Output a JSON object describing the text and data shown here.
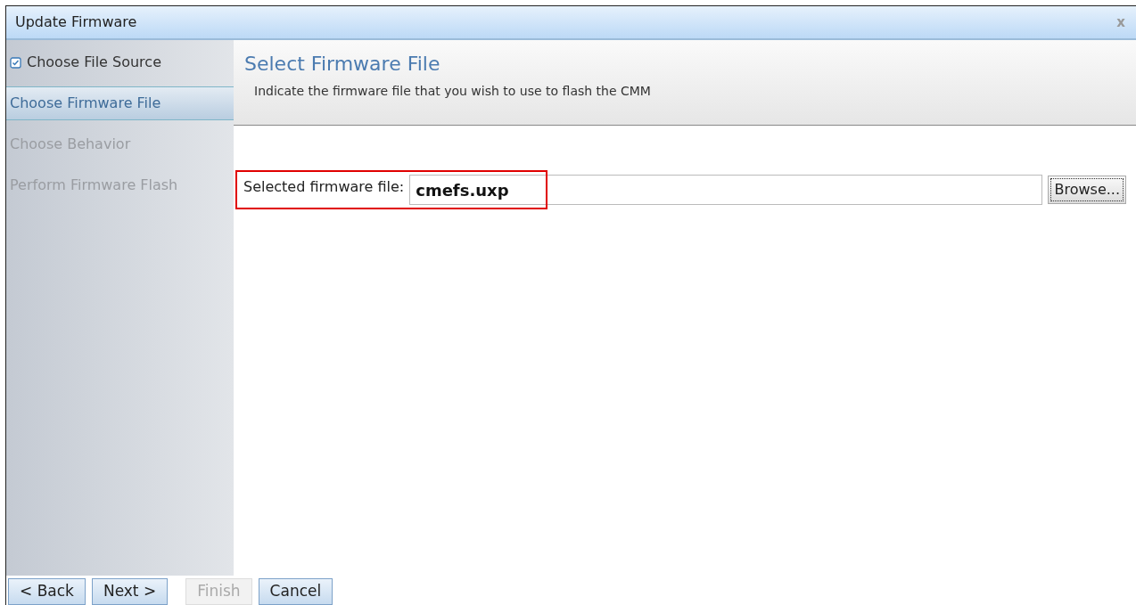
{
  "window": {
    "title": "Update Firmware",
    "close": "x"
  },
  "steps": [
    {
      "label": "Choose File Source",
      "checked": true,
      "selected": false,
      "disabled": false
    },
    {
      "label": "Choose Firmware File",
      "checked": false,
      "selected": true,
      "disabled": false
    },
    {
      "label": "Choose Behavior",
      "checked": false,
      "selected": false,
      "disabled": true
    },
    {
      "label": "Perform Firmware Flash",
      "checked": false,
      "selected": false,
      "disabled": true
    }
  ],
  "header": {
    "title": "Select Firmware File",
    "description": "Indicate the firmware file that you wish to use to flash the CMM"
  },
  "file_field": {
    "label": "Selected firmware file:",
    "value": "cmefs.uxp",
    "highlighted": true,
    "browse": "Browse..."
  },
  "buttons": [
    {
      "label": "< Back",
      "disabled": false
    },
    {
      "label": "Next >",
      "disabled": false
    },
    {
      "label": "Finish",
      "disabled": true
    },
    {
      "label": "Cancel",
      "disabled": false
    }
  ]
}
